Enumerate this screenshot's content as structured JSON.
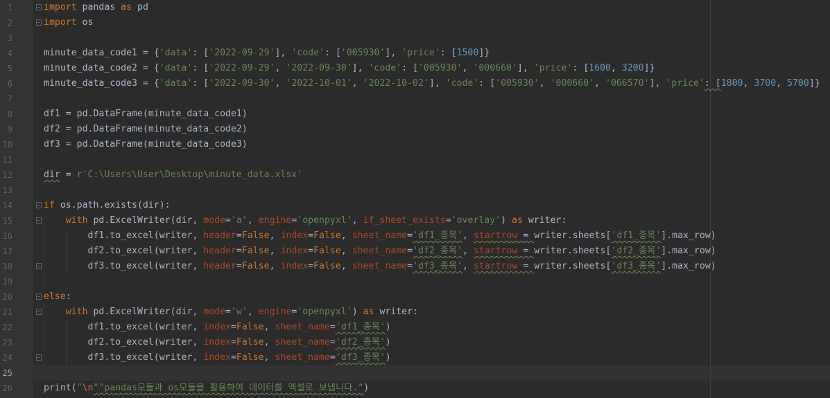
{
  "editor": {
    "line_numbers": [
      "1",
      "2",
      "3",
      "4",
      "5",
      "6",
      "7",
      "8",
      "9",
      "10",
      "11",
      "12",
      "13",
      "14",
      "15",
      "16",
      "17",
      "18",
      "19",
      "20",
      "21",
      "22",
      "23",
      "24",
      "25",
      "26"
    ],
    "current_line": "25"
  },
  "code": {
    "l1": {
      "kw_import": "import",
      "mod": " pandas ",
      "kw_as": "as",
      "alias": " pd"
    },
    "l2": {
      "kw_import": "import",
      "mod": " os"
    },
    "l4": {
      "t1": "minute_data_code1 = {",
      "s1": "'data'",
      "t2": ": [",
      "s2": "'2022-09-29'",
      "t3": "], ",
      "s3": "'code'",
      "t4": ": [",
      "s4": "'005930'",
      "t5": "], ",
      "s5": "'price'",
      "t6": ": [",
      "n1": "1500",
      "t7": "]}"
    },
    "l5": {
      "t1": "minute_data_code2 = {",
      "s1": "'data'",
      "t2": ": [",
      "s2": "'2022-09-29'",
      "t3": ", ",
      "s3": "'2022-09-30'",
      "t4": "], ",
      "s4": "'code'",
      "t5": ": [",
      "s5": "'005930'",
      "t6": ", ",
      "s6": "'000660'",
      "t7": "], ",
      "s7": "'price'",
      "t8": ": [",
      "n1": "1600",
      "t9": ", ",
      "n2": "3200",
      "t10": "]}"
    },
    "l6": {
      "t1": "minute_data_code3 = {",
      "s1": "'data'",
      "t2": ": [",
      "s2": "'2022-09-30'",
      "t3": ", ",
      "s3": "'2022-10-01'",
      "t4": ", ",
      "s4": "'2022-10-02'",
      "t5": "], ",
      "s5": "'code'",
      "t6": ": [",
      "s6": "'005930'",
      "t7": ", ",
      "s7": "'000660'",
      "t8": ", ",
      "s8": "'066570'",
      "t9": "], ",
      "s9": "'price'",
      "t10": ": [",
      "n1": "1800",
      "t11": ", ",
      "n2": "3700",
      "t12": ", ",
      "n3": "5700",
      "t13": "]}"
    },
    "l8": "df1 = pd.DataFrame(minute_data_code1)",
    "l9": "df2 = pd.DataFrame(minute_data_code2)",
    "l10": "df3 = pd.DataFrame(minute_data_code3)",
    "l12": {
      "var": "dir",
      "t1": " = ",
      "s1": "r'C:\\Users\\User\\Desktop\\minute_data.xlsx'"
    },
    "l14": {
      "kw": "if",
      "t1": " os.path.exists(dir):"
    },
    "l15": {
      "indent": "    ",
      "kw": "with",
      "t1": " pd.ExcelWriter(dir, ",
      "k1": "mode",
      "e1": "=",
      "s1": "'a'",
      "t2": ", ",
      "k2": "engine",
      "e2": "=",
      "s2": "'openpyxl'",
      "t3": ", ",
      "k3": "if_sheet_exists",
      "e3": "=",
      "s3": "'overlay'",
      "t4": ") ",
      "kw2": "as",
      "t5": " writer:"
    },
    "l16": {
      "indent": "        ",
      "t1": "df1.to_excel(writer, ",
      "k1": "header",
      "e1": "=",
      "v1": "False",
      "t2": ", ",
      "k2": "index",
      "e2": "=",
      "v2": "False",
      "t3": ", ",
      "k3": "sheet_name",
      "e3": "=",
      "s1": "'df1_종목'",
      "t4": ", ",
      "k4": "startrow",
      "t5": " = ",
      "t6": "writer.sheets[",
      "s2": "'df1_종목'",
      "t7": "].max_row)"
    },
    "l17": {
      "indent": "        ",
      "t1": "df2.to_excel(writer, ",
      "k1": "header",
      "e1": "=",
      "v1": "False",
      "t2": ", ",
      "k2": "index",
      "e2": "=",
      "v2": "False",
      "t3": ", ",
      "k3": "sheet_name",
      "e3": "=",
      "s1": "'df2_종목'",
      "t4": ", ",
      "k4": "startrow",
      "t5": " = ",
      "t6": "writer.sheets[",
      "s2": "'df2_종목'",
      "t7": "].max_row)"
    },
    "l18": {
      "indent": "        ",
      "t1": "df3.to_excel(writer, ",
      "k1": "header",
      "e1": "=",
      "v1": "False",
      "t2": ", ",
      "k2": "index",
      "e2": "=",
      "v2": "False",
      "t3": ", ",
      "k3": "sheet_name",
      "e3": "=",
      "s1": "'df3_종목'",
      "t4": ", ",
      "k4": "startrow",
      "t5": " = ",
      "t6": "writer.sheets[",
      "s2": "'df3_종목'",
      "t7": "].max_row)"
    },
    "l20": {
      "kw": "else",
      "t1": ":"
    },
    "l21": {
      "indent": "    ",
      "kw": "with",
      "t1": " pd.ExcelWriter(dir, ",
      "k1": "mode",
      "e1": "=",
      "s1": "'w'",
      "t2": ", ",
      "k2": "engine",
      "e2": "=",
      "s2": "'openpyxl'",
      "t3": ") ",
      "kw2": "as",
      "t4": " writer:"
    },
    "l22": {
      "indent": "        ",
      "t1": "df1.to_excel(writer, ",
      "k1": "index",
      "e1": "=",
      "v1": "False",
      "t2": ", ",
      "k2": "sheet_name",
      "e2": "=",
      "s1": "'df1_종목'",
      "t3": ")"
    },
    "l23": {
      "indent": "        ",
      "t1": "df2.to_excel(writer, ",
      "k1": "index",
      "e1": "=",
      "v1": "False",
      "t2": ", ",
      "k2": "sheet_name",
      "e2": "=",
      "s1": "'df2_종목'",
      "t3": ")"
    },
    "l24": {
      "indent": "        ",
      "t1": "df3.to_excel(writer, ",
      "k1": "index",
      "e1": "=",
      "v1": "False",
      "t2": ", ",
      "k2": "sheet_name",
      "e2": "=",
      "s1": "'df3_종목'",
      "t3": ")"
    },
    "l26": {
      "t1": "print(",
      "s1": "\"",
      "esc": "\\n",
      "s2": "\"\"pandas모듈과 os모듈을 활용하여 데이터를 엑셀로 보냅니다.\"",
      "t2": ")"
    }
  },
  "colors": {
    "background": "#2b2b2b",
    "gutter": "#313335",
    "keyword": "#cc7832",
    "string": "#6a8759",
    "number": "#6897bb",
    "kwarg": "#aa4926",
    "text": "#a9b7c6"
  }
}
